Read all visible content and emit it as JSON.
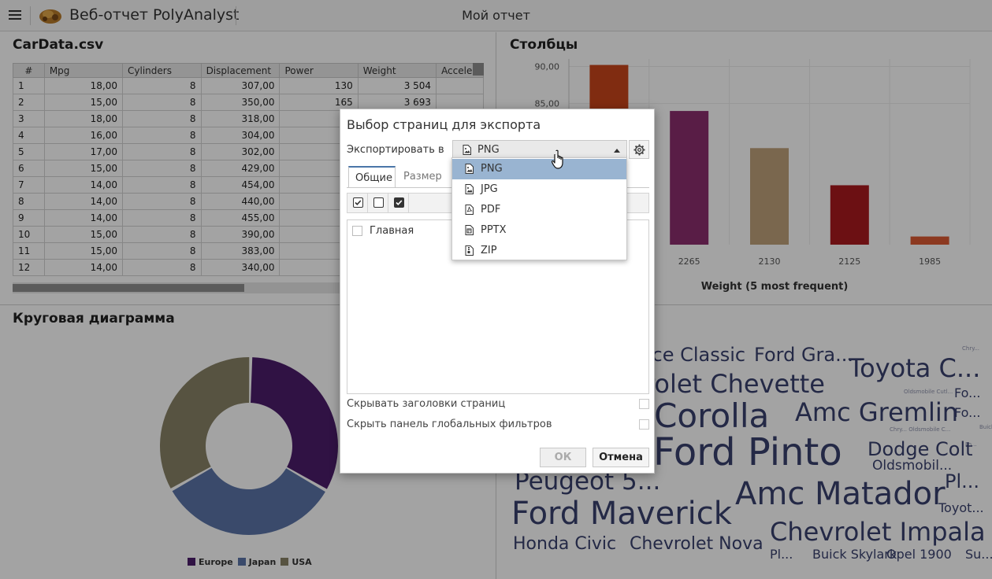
{
  "header": {
    "app_title": "Веб-отчет PolyAnalyst",
    "report_title": "Мой отчет"
  },
  "table_panel": {
    "title": "CarData.csv",
    "columns": [
      "#",
      "Mpg",
      "Cylinders",
      "Displacement",
      "Power",
      "Weight",
      "Accele"
    ],
    "rows": [
      [
        "1",
        "18,00",
        "8",
        "307,00",
        "130",
        "3 504"
      ],
      [
        "2",
        "15,00",
        "8",
        "350,00",
        "165",
        "3 693"
      ],
      [
        "3",
        "18,00",
        "8",
        "318,00",
        "",
        ""
      ],
      [
        "4",
        "16,00",
        "8",
        "304,00",
        "",
        ""
      ],
      [
        "5",
        "17,00",
        "8",
        "302,00",
        "",
        ""
      ],
      [
        "6",
        "15,00",
        "8",
        "429,00",
        "",
        ""
      ],
      [
        "7",
        "14,00",
        "8",
        "454,00",
        "",
        ""
      ],
      [
        "8",
        "14,00",
        "8",
        "440,00",
        "",
        ""
      ],
      [
        "9",
        "14,00",
        "8",
        "455,00",
        "",
        ""
      ],
      [
        "10",
        "15,00",
        "8",
        "390,00",
        "",
        ""
      ],
      [
        "11",
        "15,00",
        "8",
        "383,00",
        "",
        ""
      ],
      [
        "12",
        "14,00",
        "8",
        "340,00",
        "",
        ""
      ]
    ]
  },
  "bars_panel": {
    "title": "Столбцы"
  },
  "pie_panel": {
    "title": "Круговая диаграмма"
  },
  "chart_data": [
    {
      "type": "bar",
      "title": "Столбцы",
      "xlabel": "Weight (5 most frequent)",
      "ylabel": "",
      "categories": [
        "",
        "2265",
        "2130",
        "2125",
        "1985"
      ],
      "values": [
        90.2,
        84.0,
        79.0,
        74.0,
        67.1
      ],
      "colors": [
        "#c8451c",
        "#8b2e6e",
        "#bfa17a",
        "#aa1a1f",
        "#dc5a33"
      ],
      "y_ticks": [
        "90,00",
        "85,00"
      ],
      "ylim": [
        66.0,
        91.0
      ],
      "grid": true
    },
    {
      "type": "pie",
      "title": "Круговая диаграмма",
      "labels": [
        "Europe",
        "Japan",
        "USA"
      ],
      "values": [
        33.0,
        33.5,
        33.5
      ],
      "colors": [
        "#4b1d6b",
        "#5b74a8",
        "#888266"
      ],
      "donut": true,
      "legend": "bottom"
    }
  ],
  "cloud": {
    "words": [
      {
        "text": "rice Classic",
        "size": 24
      },
      {
        "text": "Ford Gra...",
        "size": 24
      },
      {
        "text": "Toyota C...",
        "size": 32
      },
      {
        "text": "Chry...",
        "size": 7
      },
      {
        "text": "Oldsmobile Cutl...",
        "size": 7
      },
      {
        "text": "Fo...",
        "size": 16
      },
      {
        "text": "vrolet Chevette",
        "size": 32
      },
      {
        "text": "a Corolla",
        "size": 42
      },
      {
        "text": "Amc Gremlin",
        "size": 32
      },
      {
        "text": "Fo...",
        "size": 16
      },
      {
        "text": "Chry... Oldsmobile C...",
        "size": 7
      },
      {
        "text": "Buick S...",
        "size": 7
      },
      {
        "text": "Ford Pinto",
        "size": 48
      },
      {
        "text": "Dodge Colt",
        "size": 24
      },
      {
        "text": "Oldsmobil...",
        "size": 17
      },
      {
        "text": "Fo...",
        "size": 7
      },
      {
        "text": "Peugeot 5...",
        "size": 31
      },
      {
        "text": "Amc Matador",
        "size": 40
      },
      {
        "text": "Pl...",
        "size": 24
      },
      {
        "text": "Ford Maverick",
        "size": 40
      },
      {
        "text": "Toyot...",
        "size": 16
      },
      {
        "text": "Chevrolet Impala",
        "size": 32
      },
      {
        "text": "Honda Civic",
        "size": 22
      },
      {
        "text": "Chevrolet Nova",
        "size": 22
      },
      {
        "text": "Pl...",
        "size": 16
      },
      {
        "text": "Buick Skylark",
        "size": 16
      },
      {
        "text": "Opel 1900",
        "size": 16
      },
      {
        "text": "Su...",
        "size": 16
      }
    ]
  },
  "dialog": {
    "title": "Выбор страниц для экспорта",
    "export_label": "Экспортировать в",
    "selected_format": "PNG",
    "tabs": [
      "Общие",
      "Размер"
    ],
    "pages": [
      "Главная"
    ],
    "hide_page_headers": "Скрывать заголовки страниц",
    "hide_global_filters": "Скрыть панель глобальных фильтров",
    "ok": "ОК",
    "cancel": "Отмена",
    "format_options": [
      "PNG",
      "JPG",
      "PDF",
      "PPTX",
      "ZIP"
    ],
    "format_icons": [
      "image-file-icon",
      "image-file-icon",
      "pdf-file-icon",
      "pptx-file-icon",
      "zip-file-icon"
    ]
  },
  "colors": {
    "overlay": "rgba(0,0,0,0.36)",
    "dropdown_selected": "#99b4d1",
    "cloud_text": "#39406e"
  }
}
